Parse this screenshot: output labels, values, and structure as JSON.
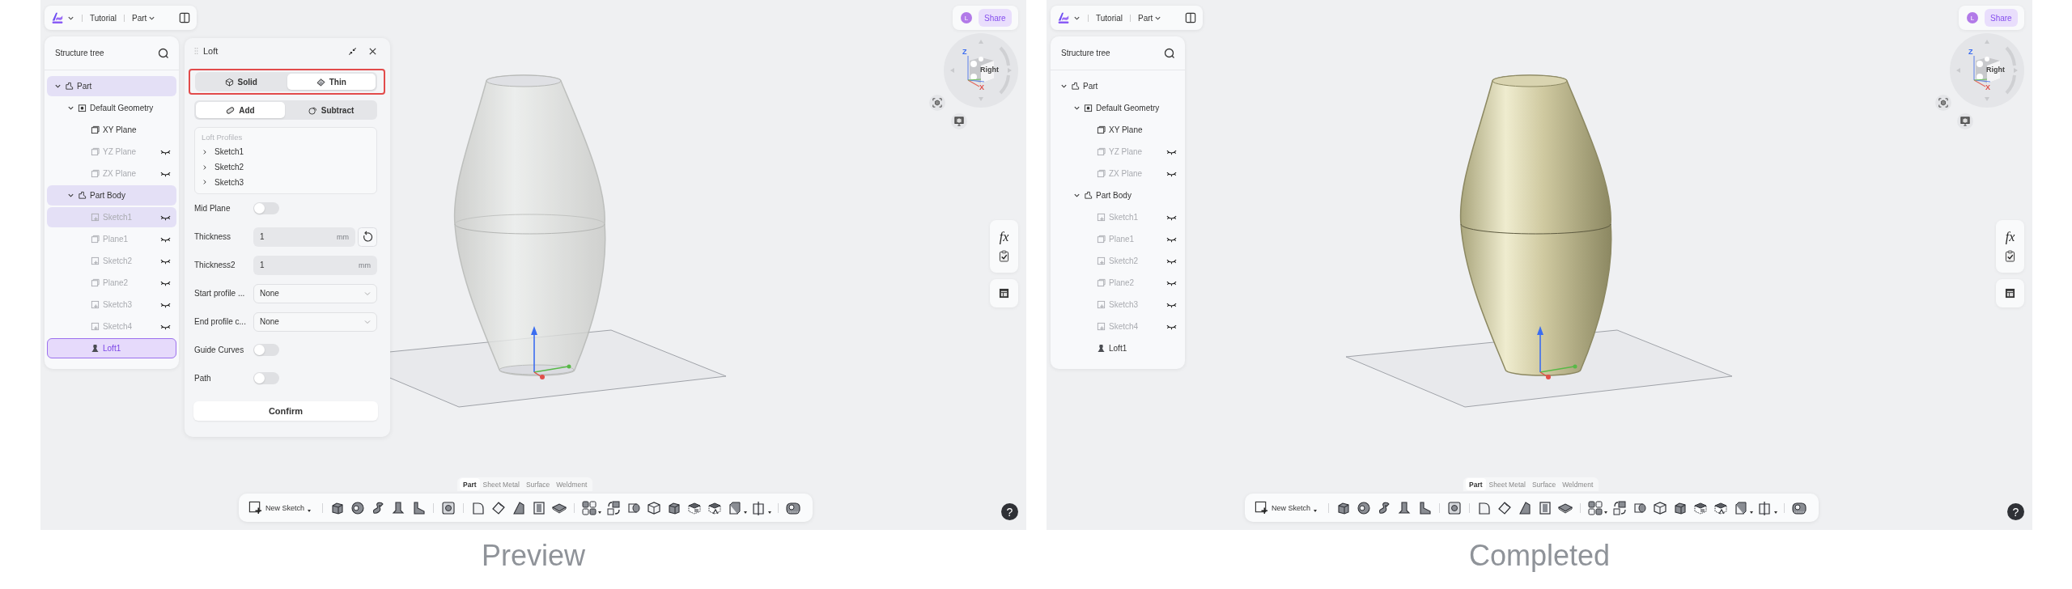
{
  "panels": [
    {
      "caption": "Preview",
      "header": {
        "title": "Tutorial",
        "mode": "Part"
      },
      "account": {
        "initial": "L",
        "share": "Share"
      },
      "view_cube": {
        "face": "Right",
        "axes": [
          "Z",
          "X"
        ]
      },
      "side_tools": {
        "formula": "fx"
      },
      "tree": {
        "title": "Structure tree",
        "items": [
          {
            "label": "Part",
            "kind": "part",
            "expanded": true,
            "hidden": false,
            "highlighted": true,
            "selected": false,
            "children": [
              {
                "label": "Default Geometry",
                "kind": "geometry",
                "expanded": true,
                "hidden": false,
                "highlighted": false,
                "selected": false,
                "children": [
                  {
                    "label": "XY Plane",
                    "kind": "plane",
                    "hidden": false,
                    "highlighted": false,
                    "selected": false
                  },
                  {
                    "label": "YZ Plane",
                    "kind": "plane",
                    "hidden": true,
                    "highlighted": false,
                    "selected": false
                  },
                  {
                    "label": "ZX Plane",
                    "kind": "plane",
                    "hidden": true,
                    "highlighted": false,
                    "selected": false
                  }
                ]
              },
              {
                "label": "Part Body",
                "kind": "body",
                "expanded": true,
                "hidden": false,
                "highlighted": true,
                "selected": false,
                "children": [
                  {
                    "label": "Sketch1",
                    "kind": "sketch",
                    "hidden": true,
                    "highlighted": true,
                    "selected": false
                  },
                  {
                    "label": "Plane1",
                    "kind": "plane",
                    "hidden": true,
                    "highlighted": false,
                    "selected": false
                  },
                  {
                    "label": "Sketch2",
                    "kind": "sketch",
                    "hidden": true,
                    "highlighted": false,
                    "selected": false
                  },
                  {
                    "label": "Plane2",
                    "kind": "plane",
                    "hidden": true,
                    "highlighted": false,
                    "selected": false
                  },
                  {
                    "label": "Sketch3",
                    "kind": "sketch",
                    "hidden": true,
                    "highlighted": false,
                    "selected": false
                  },
                  {
                    "label": "Sketch4",
                    "kind": "sketch",
                    "hidden": true,
                    "highlighted": false,
                    "selected": false
                  },
                  {
                    "label": "Loft1",
                    "kind": "loft",
                    "hidden": false,
                    "highlighted": false,
                    "selected": true
                  }
                ]
              }
            ]
          }
        ]
      },
      "loft_dialog": {
        "title": "Loft",
        "outlined": true,
        "body_type": [
          {
            "label": "Solid",
            "kind": "solid",
            "selected": false
          },
          {
            "label": "Thin",
            "kind": "thin",
            "selected": true
          }
        ],
        "operation": [
          {
            "label": "Add",
            "kind": "add",
            "selected": true
          },
          {
            "label": "Subtract",
            "kind": "subtract",
            "selected": false
          }
        ],
        "profiles": {
          "heading": "Loft Profiles",
          "items": [
            "Sketch1",
            "Sketch2",
            "Sketch3"
          ]
        },
        "rows": [
          {
            "kind": "toggle",
            "label": "Mid Plane",
            "on": false
          },
          {
            "kind": "number",
            "label": "Thickness",
            "value": "1",
            "unit": "mm",
            "reset": true
          },
          {
            "kind": "number",
            "label": "Thickness2",
            "value": "1",
            "unit": "mm",
            "reset": false
          },
          {
            "kind": "select",
            "label": "Start profile ...",
            "value": "None"
          },
          {
            "kind": "select",
            "label": "End profile c...",
            "value": "None"
          },
          {
            "kind": "toggle",
            "label": "Guide Curves",
            "on": false
          },
          {
            "kind": "toggle",
            "label": "Path",
            "on": false
          }
        ],
        "confirm": "Confirm"
      },
      "model": {
        "kind": "translucent"
      },
      "modes": [
        {
          "label": "Part",
          "selected": true
        },
        {
          "label": "Sheet Metal",
          "selected": false
        },
        {
          "label": "Surface",
          "selected": false
        },
        {
          "label": "Weldment",
          "selected": false
        }
      ],
      "toolbar": {
        "new_sketch": "New Sketch"
      },
      "help": "?"
    },
    {
      "caption": "Completed",
      "header": {
        "title": "Tutorial",
        "mode": "Part"
      },
      "account": {
        "initial": "L",
        "share": "Share"
      },
      "view_cube": {
        "face": "Right",
        "axes": [
          "Z",
          "X"
        ]
      },
      "side_tools": {
        "formula": "fx"
      },
      "tree": {
        "title": "Structure tree",
        "items": [
          {
            "label": "Part",
            "kind": "part",
            "expanded": true,
            "hidden": false,
            "highlighted": false,
            "selected": false,
            "children": [
              {
                "label": "Default Geometry",
                "kind": "geometry",
                "expanded": true,
                "hidden": false,
                "highlighted": false,
                "selected": false,
                "children": [
                  {
                    "label": "XY Plane",
                    "kind": "plane",
                    "hidden": false,
                    "highlighted": false,
                    "selected": false
                  },
                  {
                    "label": "YZ Plane",
                    "kind": "plane",
                    "hidden": true,
                    "highlighted": false,
                    "selected": false
                  },
                  {
                    "label": "ZX Plane",
                    "kind": "plane",
                    "hidden": true,
                    "highlighted": false,
                    "selected": false
                  }
                ]
              },
              {
                "label": "Part Body",
                "kind": "body",
                "expanded": true,
                "hidden": false,
                "highlighted": false,
                "selected": false,
                "children": [
                  {
                    "label": "Sketch1",
                    "kind": "sketch",
                    "hidden": true,
                    "highlighted": false,
                    "selected": false
                  },
                  {
                    "label": "Plane1",
                    "kind": "plane",
                    "hidden": true,
                    "highlighted": false,
                    "selected": false
                  },
                  {
                    "label": "Sketch2",
                    "kind": "sketch",
                    "hidden": true,
                    "highlighted": false,
                    "selected": false
                  },
                  {
                    "label": "Plane2",
                    "kind": "plane",
                    "hidden": true,
                    "highlighted": false,
                    "selected": false
                  },
                  {
                    "label": "Sketch3",
                    "kind": "sketch",
                    "hidden": true,
                    "highlighted": false,
                    "selected": false
                  },
                  {
                    "label": "Sketch4",
                    "kind": "sketch",
                    "hidden": true,
                    "highlighted": false,
                    "selected": false
                  },
                  {
                    "label": "Loft1",
                    "kind": "loft",
                    "hidden": false,
                    "highlighted": false,
                    "selected": false
                  }
                ]
              }
            ]
          }
        ]
      },
      "model": {
        "kind": "shaded"
      },
      "modes": [
        {
          "label": "Part",
          "selected": true
        },
        {
          "label": "Sheet Metal",
          "selected": false
        },
        {
          "label": "Surface",
          "selected": false
        },
        {
          "label": "Weldment",
          "selected": false
        }
      ],
      "toolbar": {
        "new_sketch": "New Sketch"
      },
      "help": "?"
    }
  ]
}
